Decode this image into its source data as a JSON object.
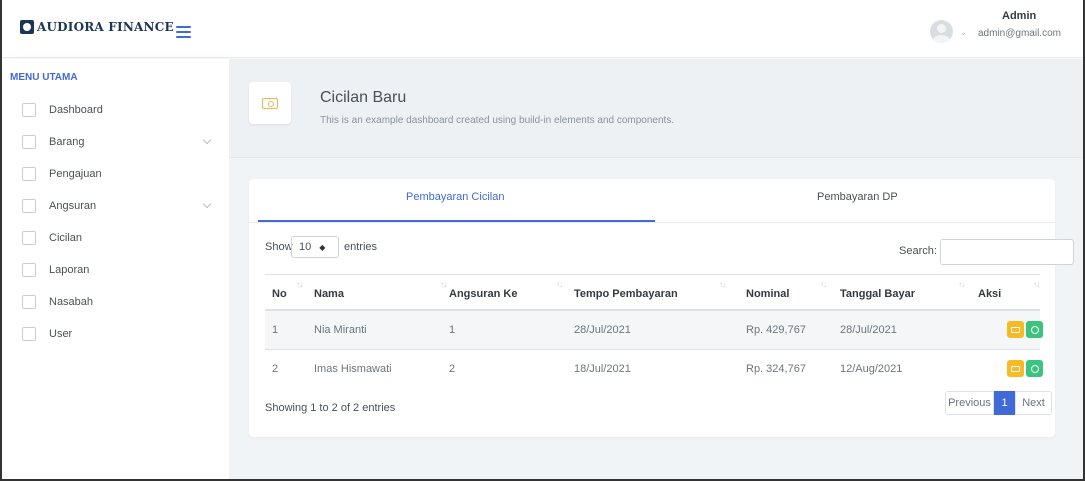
{
  "header": {
    "brand": "AUDIORA FINANCE",
    "user_name": "Admin",
    "user_email": "admin@gmail.com"
  },
  "sidebar": {
    "heading": "MENU UTAMA",
    "items": [
      {
        "label": "Dashboard",
        "icon": "home-icon",
        "expandable": false
      },
      {
        "label": "Barang",
        "icon": "box-icon",
        "expandable": true
      },
      {
        "label": "Pengajuan",
        "icon": "clipboard-icon",
        "expandable": false
      },
      {
        "label": "Angsuran",
        "icon": "clipboard-icon",
        "expandable": true
      },
      {
        "label": "Cicilan",
        "icon": "money-icon",
        "expandable": false
      },
      {
        "label": "Laporan",
        "icon": "report-icon",
        "expandable": false
      },
      {
        "label": "Nasabah",
        "icon": "users-icon",
        "expandable": false
      },
      {
        "label": "User",
        "icon": "id-card-icon",
        "expandable": false
      }
    ]
  },
  "page": {
    "title": "Cicilan Baru",
    "subtitle": "This is an example dashboard created using build-in elements and components.",
    "icon": "money-icon"
  },
  "tabs": [
    {
      "label": "Pembayaran Cicilan",
      "active": true
    },
    {
      "label": "Pembayaran DP",
      "active": false
    }
  ],
  "table_controls": {
    "show_label": "Show",
    "entries_value": "10",
    "entries_label": "entries",
    "search_label": "Search:",
    "search_value": ""
  },
  "table": {
    "columns": [
      "No",
      "Nama",
      "Angsuran Ke",
      "Tempo Pembayaran",
      "Nominal",
      "Tanggal Bayar",
      "Aksi"
    ],
    "rows": [
      {
        "no": "1",
        "nama": "Nia Miranti",
        "angsuran_ke": "1",
        "tempo": "28/Jul/2021",
        "nominal": "Rp. 429,767",
        "tanggal_bayar": "28/Jul/2021"
      },
      {
        "no": "2",
        "nama": "Imas Hismawati",
        "angsuran_ke": "2",
        "tempo": "18/Jul/2021",
        "nominal": "Rp. 324,767",
        "tanggal_bayar": "12/Aug/2021"
      }
    ],
    "info": "Showing 1 to 2 of 2 entries"
  },
  "pagination": {
    "previous": "Previous",
    "current": "1",
    "next": "Next"
  },
  "colors": {
    "primary": "#3f6ad8",
    "warning": "#f7b924",
    "success": "#3ac47d"
  }
}
